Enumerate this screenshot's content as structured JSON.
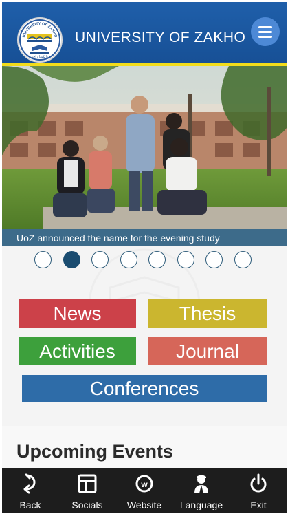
{
  "header": {
    "title": "UNIVERSITY OF ZAKHO",
    "logo_text": "UNIVERSITY OF ZAKHO",
    "logo_subtext": "زانكويا زاخو",
    "menu_icon": "hamburger-menu-icon",
    "background_color": "#1f5faa",
    "stripe_color": "#f2dc1b"
  },
  "slider": {
    "caption": "UoZ announced the name for the evening study",
    "dot_count": 8,
    "active_index": 1
  },
  "tiles": {
    "news": "News",
    "thesis": "Thesis",
    "activities": "Activities",
    "journal": "Journal",
    "conferences": "Conferences"
  },
  "events": {
    "title": "Upcoming Events"
  },
  "bottom_nav": {
    "back": "Back",
    "socials": "Socials",
    "website": "Website",
    "language": "Language",
    "exit": "Exit"
  }
}
